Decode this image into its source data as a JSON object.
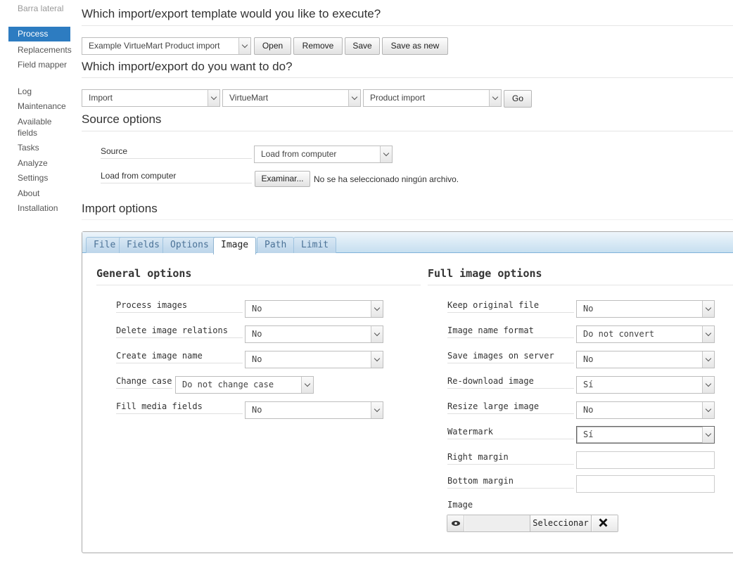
{
  "sidebar": {
    "title": "Barra lateral",
    "items": [
      {
        "label": "Process"
      },
      {
        "label": "Replacements"
      },
      {
        "label": "Field mapper"
      },
      {
        "label": "Log"
      },
      {
        "label": "Maintenance"
      },
      {
        "label": "Available fields"
      },
      {
        "label": "Tasks"
      },
      {
        "label": "Analyze"
      },
      {
        "label": "Settings"
      },
      {
        "label": "About"
      },
      {
        "label": "Installation"
      }
    ]
  },
  "template": {
    "heading": "Which import/export template would you like to execute?",
    "selected": "Example VirtueMart Product import",
    "buttons": {
      "open": "Open",
      "remove": "Remove",
      "save": "Save",
      "save_as_new": "Save as new"
    }
  },
  "operation": {
    "heading": "Which import/export do you want to do?",
    "action": "Import",
    "component": "VirtueMart",
    "type": "Product import",
    "go": "Go"
  },
  "source": {
    "heading": "Source options",
    "source_label": "Source",
    "source_value": "Load from computer",
    "file_label": "Load from computer",
    "browse": "Examinar...",
    "no_file": "No se ha seleccionado ningún archivo."
  },
  "import_options": {
    "heading": "Import options",
    "tabs": [
      {
        "label": "File"
      },
      {
        "label": "Fields"
      },
      {
        "label": "Options"
      },
      {
        "label": "Image"
      },
      {
        "label": "Path"
      },
      {
        "label": "Limit"
      }
    ],
    "general": {
      "heading": "General options",
      "process_images": {
        "label": "Process images",
        "value": "No"
      },
      "delete_relations": {
        "label": "Delete image relations",
        "value": "No"
      },
      "create_name": {
        "label": "Create image name",
        "value": "No"
      },
      "change_case": {
        "label": "Change case",
        "value": "Do not change case"
      },
      "fill_media": {
        "label": "Fill media fields",
        "value": "No"
      }
    },
    "full": {
      "heading": "Full image options",
      "keep_original": {
        "label": "Keep original file",
        "value": "No"
      },
      "name_format": {
        "label": "Image name format",
        "value": "Do not convert"
      },
      "save_server": {
        "label": "Save images on server",
        "value": "No"
      },
      "redownload": {
        "label": "Re-download image",
        "value": "Sí"
      },
      "resize": {
        "label": "Resize large image",
        "value": "No"
      },
      "watermark": {
        "label": "Watermark",
        "value": "Sí"
      },
      "right_margin": {
        "label": "Right margin",
        "value": ""
      },
      "bottom_margin": {
        "label": "Bottom margin",
        "value": ""
      },
      "image": {
        "label": "Image",
        "select_button": "Seleccionar"
      }
    }
  },
  "colors": {
    "accent": "#2d7cc1",
    "tab_bar": "#c6dff0"
  }
}
